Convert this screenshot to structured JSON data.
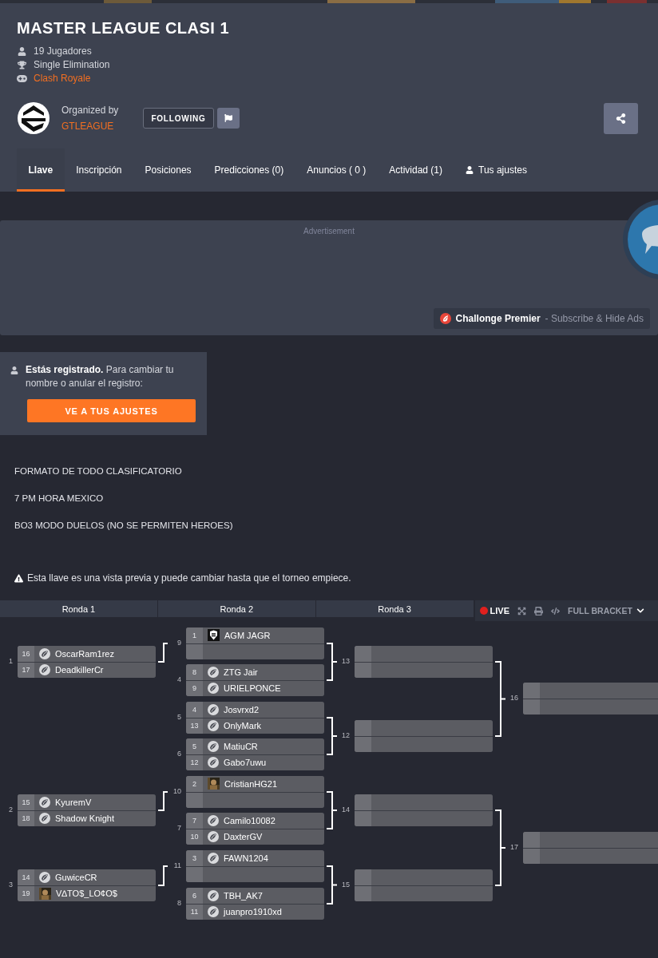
{
  "tournament": {
    "title": "MASTER LEAGUE CLASI 1",
    "info": [
      {
        "kind": "players",
        "text": "19 Jugadores"
      },
      {
        "kind": "format",
        "text": "Single Elimination"
      },
      {
        "kind": "game",
        "text": "Clash Royale"
      }
    ]
  },
  "organizer": {
    "label": "Organized by",
    "name": "GTLEAGUE",
    "follow_button": "FOLLOWING"
  },
  "tabs": [
    {
      "label": "Llave",
      "selected": true,
      "kind": "plain"
    },
    {
      "label": "Inscripción",
      "selected": false,
      "kind": "plain"
    },
    {
      "label": "Posiciones",
      "selected": false,
      "kind": "plain"
    },
    {
      "label": "Predicciones (0)",
      "selected": false,
      "kind": "plain"
    },
    {
      "label": "Anuncios ( 0 )",
      "selected": false,
      "kind": "plain"
    },
    {
      "label": "Actividad (1)",
      "selected": false,
      "kind": "plain"
    },
    {
      "label": "Tus ajustes",
      "selected": false,
      "kind": "user"
    }
  ],
  "ad": {
    "label": "Advertisement",
    "premier": "Challonge Premier",
    "premier_note": "- Subscribe & Hide Ads"
  },
  "registration": {
    "text": "**Estás registrado.** Para cambiar tu nombre o anular el registro:",
    "button": "VE A TUS AJUSTES"
  },
  "description": [
    "FORMATO DE TODO CLASIFICATORIO",
    "7 PM HORA MEXICO",
    "BO3 MODO DUELOS (NO SE PERMITEN HEROES)"
  ],
  "notice": "Esta llave es una vista previa y puede cambiar hasta que el torneo empiece.",
  "round_headers": [
    "Ronda 1",
    "Ronda 2",
    "Ronda 3"
  ],
  "toolbar": {
    "live": "LIVE",
    "full_bracket": "FULL BRACKET"
  },
  "rounds": [
    {
      "matches": [
        {
          "number": "1",
          "players": [
            {
              "kind": "player",
              "seed": "16",
              "name": "OscarRam1rez",
              "avatar": {
                "kind": "default"
              }
            },
            {
              "kind": "player",
              "seed": "17",
              "name": "DeadkillerCr",
              "avatar": {
                "kind": "default"
              }
            }
          ]
        },
        {
          "number": "2",
          "players": [
            {
              "kind": "player",
              "seed": "15",
              "name": "KyuremV",
              "avatar": {
                "kind": "default"
              }
            },
            {
              "kind": "player",
              "seed": "18",
              "name": "Shadow Knight",
              "avatar": {
                "kind": "default"
              }
            }
          ]
        },
        {
          "number": "3",
          "players": [
            {
              "kind": "player",
              "seed": "14",
              "name": "GuwiceCR",
              "avatar": {
                "kind": "default"
              }
            },
            {
              "kind": "player",
              "seed": "19",
              "name": "V∆TO$_LO¢O$"
            }
          ]
        }
      ]
    },
    {
      "matches": [
        {
          "number": "9",
          "players": [
            {
              "kind": "player",
              "seed": "1",
              "name": "AGM JAGR",
              "avatar": {
                "kind": "logo"
              }
            },
            {
              "kind": "empty"
            }
          ]
        },
        {
          "number": "4",
          "players": [
            {
              "kind": "player",
              "seed": "8",
              "name": "ZTG Jair",
              "avatar": {
                "kind": "default"
              }
            },
            {
              "kind": "player",
              "seed": "9",
              "name": "URIELPONCE",
              "avatar": {
                "kind": "default"
              }
            }
          ]
        },
        {
          "number": "5",
          "players": [
            {
              "kind": "player",
              "seed": "4",
              "name": "Josvrxd2",
              "avatar": {
                "kind": "default"
              }
            },
            {
              "kind": "player",
              "seed": "13",
              "name": "OnlyMark",
              "avatar": {
                "kind": "default"
              }
            }
          ]
        },
        {
          "number": "6",
          "players": [
            {
              "kind": "player",
              "seed": "5",
              "name": "MatiuCR",
              "avatar": {
                "kind": "default"
              }
            },
            {
              "kind": "player",
              "seed": "12",
              "name": "Gabo7uwu",
              "avatar": {
                "kind": "default"
              }
            }
          ]
        },
        {
          "number": "10",
          "players": [
            {
              "kind": "player",
              "seed": "2",
              "name": "CristianHG21"
            },
            {
              "kind": "empty"
            }
          ]
        },
        {
          "number": "7",
          "players": [
            {
              "kind": "player",
              "seed": "7",
              "name": "Camilo10082",
              "avatar": {
                "kind": "default"
              }
            },
            {
              "kind": "player",
              "seed": "10",
              "name": "DaxterGV",
              "avatar": {
                "kind": "default"
              }
            }
          ]
        },
        {
          "number": "11",
          "players": [
            {
              "kind": "player",
              "seed": "3",
              "name": "FAWN1204",
              "avatar": {
                "kind": "default"
              }
            },
            {
              "kind": "empty"
            }
          ]
        },
        {
          "number": "8",
          "players": [
            {
              "kind": "player",
              "seed": "6",
              "name": "TBH_AK7",
              "avatar": {
                "kind": "default"
              }
            },
            {
              "kind": "player",
              "seed": "11",
              "name": "juanpro1910xd",
              "avatar": {
                "kind": "default"
              }
            }
          ]
        }
      ]
    },
    {
      "matches": [
        {
          "number": "13",
          "players": [
            {
              "kind": "empty"
            },
            {
              "kind": "empty"
            }
          ]
        },
        {
          "number": "12",
          "players": [
            {
              "kind": "empty"
            },
            {
              "kind": "empty"
            }
          ]
        },
        {
          "number": "14",
          "players": [
            {
              "kind": "empty"
            },
            {
              "kind": "empty"
            }
          ]
        },
        {
          "number": "15",
          "players": [
            {
              "kind": "empty"
            },
            {
              "kind": "empty"
            }
          ]
        }
      ]
    },
    {
      "matches": [
        {
          "number": "16",
          "players": [
            {
              "kind": "empty"
            },
            {
              "kind": "empty"
            }
          ]
        },
        {
          "number": "17",
          "players": [
            {
              "kind": "empty"
            },
            {
              "kind": "empty"
            }
          ]
        }
      ]
    }
  ]
}
